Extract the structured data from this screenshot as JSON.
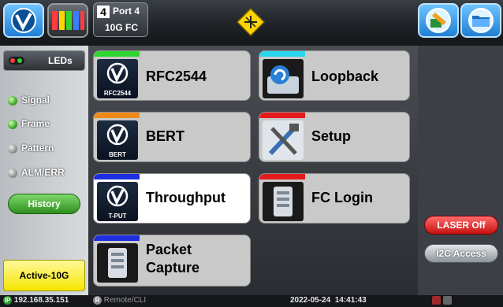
{
  "port": {
    "number": "4",
    "name": "Port 4",
    "type": "10G FC"
  },
  "left": {
    "leds_label": "LEDs",
    "leds": [
      {
        "label": "Signal",
        "color": "#4caf32"
      },
      {
        "label": "Frame",
        "color": "#4caf32"
      },
      {
        "label": "Pattern",
        "color": "#9a9a9a"
      },
      {
        "label": "ALM/ERR",
        "color": "#9a9a9a"
      }
    ],
    "history_label": "History",
    "active_label": "Active-10G"
  },
  "tiles": [
    {
      "label": "RFC2544",
      "sub": "RFC2544",
      "strip_color": "#2fd62f"
    },
    {
      "label": "Loopback",
      "sub": "",
      "strip_color": "#29d6ef"
    },
    {
      "label": "BERT",
      "sub": "BERT",
      "strip_color": "#f08a18"
    },
    {
      "label": "Setup",
      "sub": "",
      "strip_color": "#e41b1b"
    },
    {
      "label": "Throughput",
      "sub": "T-PUT",
      "strip_color": "#1d2ee0"
    },
    {
      "label": "FC Login",
      "sub": "",
      "strip_color": "#e41b1b"
    },
    {
      "label": "Packet",
      "label2": "Capture",
      "sub": "",
      "strip_color": "#1d2ee0"
    }
  ],
  "right": {
    "laser_label": "LASER Off",
    "i2c_label": "I2C Access"
  },
  "status": {
    "ip": "192.168.35.151",
    "remote": "Remote/CLI",
    "datetime": "2022-05-24  14:41:43"
  }
}
